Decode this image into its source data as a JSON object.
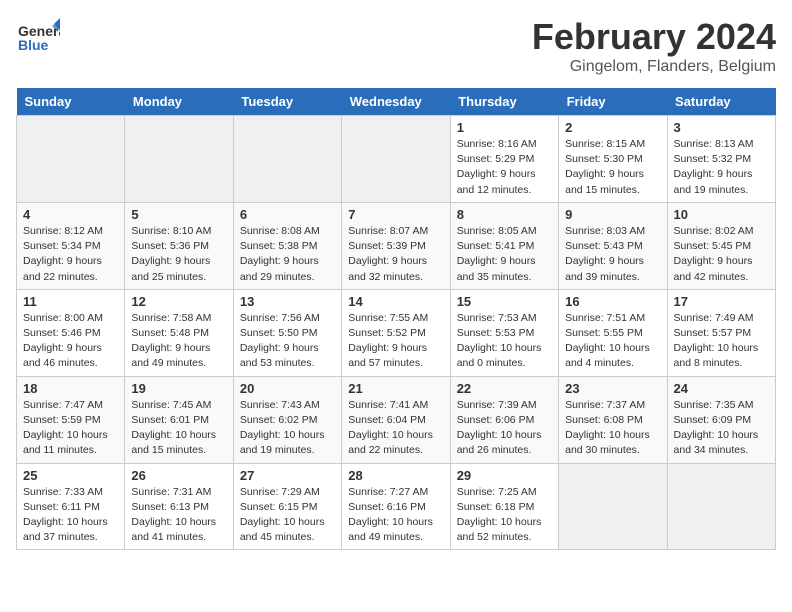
{
  "logo": {
    "line1": "General",
    "line2": "Blue"
  },
  "title": "February 2024",
  "subtitle": "Gingelom, Flanders, Belgium",
  "weekdays": [
    "Sunday",
    "Monday",
    "Tuesday",
    "Wednesday",
    "Thursday",
    "Friday",
    "Saturday"
  ],
  "weeks": [
    [
      {
        "day": "",
        "info": ""
      },
      {
        "day": "",
        "info": ""
      },
      {
        "day": "",
        "info": ""
      },
      {
        "day": "",
        "info": ""
      },
      {
        "day": "1",
        "info": "Sunrise: 8:16 AM\nSunset: 5:29 PM\nDaylight: 9 hours\nand 12 minutes."
      },
      {
        "day": "2",
        "info": "Sunrise: 8:15 AM\nSunset: 5:30 PM\nDaylight: 9 hours\nand 15 minutes."
      },
      {
        "day": "3",
        "info": "Sunrise: 8:13 AM\nSunset: 5:32 PM\nDaylight: 9 hours\nand 19 minutes."
      }
    ],
    [
      {
        "day": "4",
        "info": "Sunrise: 8:12 AM\nSunset: 5:34 PM\nDaylight: 9 hours\nand 22 minutes."
      },
      {
        "day": "5",
        "info": "Sunrise: 8:10 AM\nSunset: 5:36 PM\nDaylight: 9 hours\nand 25 minutes."
      },
      {
        "day": "6",
        "info": "Sunrise: 8:08 AM\nSunset: 5:38 PM\nDaylight: 9 hours\nand 29 minutes."
      },
      {
        "day": "7",
        "info": "Sunrise: 8:07 AM\nSunset: 5:39 PM\nDaylight: 9 hours\nand 32 minutes."
      },
      {
        "day": "8",
        "info": "Sunrise: 8:05 AM\nSunset: 5:41 PM\nDaylight: 9 hours\nand 35 minutes."
      },
      {
        "day": "9",
        "info": "Sunrise: 8:03 AM\nSunset: 5:43 PM\nDaylight: 9 hours\nand 39 minutes."
      },
      {
        "day": "10",
        "info": "Sunrise: 8:02 AM\nSunset: 5:45 PM\nDaylight: 9 hours\nand 42 minutes."
      }
    ],
    [
      {
        "day": "11",
        "info": "Sunrise: 8:00 AM\nSunset: 5:46 PM\nDaylight: 9 hours\nand 46 minutes."
      },
      {
        "day": "12",
        "info": "Sunrise: 7:58 AM\nSunset: 5:48 PM\nDaylight: 9 hours\nand 49 minutes."
      },
      {
        "day": "13",
        "info": "Sunrise: 7:56 AM\nSunset: 5:50 PM\nDaylight: 9 hours\nand 53 minutes."
      },
      {
        "day": "14",
        "info": "Sunrise: 7:55 AM\nSunset: 5:52 PM\nDaylight: 9 hours\nand 57 minutes."
      },
      {
        "day": "15",
        "info": "Sunrise: 7:53 AM\nSunset: 5:53 PM\nDaylight: 10 hours\nand 0 minutes."
      },
      {
        "day": "16",
        "info": "Sunrise: 7:51 AM\nSunset: 5:55 PM\nDaylight: 10 hours\nand 4 minutes."
      },
      {
        "day": "17",
        "info": "Sunrise: 7:49 AM\nSunset: 5:57 PM\nDaylight: 10 hours\nand 8 minutes."
      }
    ],
    [
      {
        "day": "18",
        "info": "Sunrise: 7:47 AM\nSunset: 5:59 PM\nDaylight: 10 hours\nand 11 minutes."
      },
      {
        "day": "19",
        "info": "Sunrise: 7:45 AM\nSunset: 6:01 PM\nDaylight: 10 hours\nand 15 minutes."
      },
      {
        "day": "20",
        "info": "Sunrise: 7:43 AM\nSunset: 6:02 PM\nDaylight: 10 hours\nand 19 minutes."
      },
      {
        "day": "21",
        "info": "Sunrise: 7:41 AM\nSunset: 6:04 PM\nDaylight: 10 hours\nand 22 minutes."
      },
      {
        "day": "22",
        "info": "Sunrise: 7:39 AM\nSunset: 6:06 PM\nDaylight: 10 hours\nand 26 minutes."
      },
      {
        "day": "23",
        "info": "Sunrise: 7:37 AM\nSunset: 6:08 PM\nDaylight: 10 hours\nand 30 minutes."
      },
      {
        "day": "24",
        "info": "Sunrise: 7:35 AM\nSunset: 6:09 PM\nDaylight: 10 hours\nand 34 minutes."
      }
    ],
    [
      {
        "day": "25",
        "info": "Sunrise: 7:33 AM\nSunset: 6:11 PM\nDaylight: 10 hours\nand 37 minutes."
      },
      {
        "day": "26",
        "info": "Sunrise: 7:31 AM\nSunset: 6:13 PM\nDaylight: 10 hours\nand 41 minutes."
      },
      {
        "day": "27",
        "info": "Sunrise: 7:29 AM\nSunset: 6:15 PM\nDaylight: 10 hours\nand 45 minutes."
      },
      {
        "day": "28",
        "info": "Sunrise: 7:27 AM\nSunset: 6:16 PM\nDaylight: 10 hours\nand 49 minutes."
      },
      {
        "day": "29",
        "info": "Sunrise: 7:25 AM\nSunset: 6:18 PM\nDaylight: 10 hours\nand 52 minutes."
      },
      {
        "day": "",
        "info": ""
      },
      {
        "day": "",
        "info": ""
      }
    ]
  ]
}
